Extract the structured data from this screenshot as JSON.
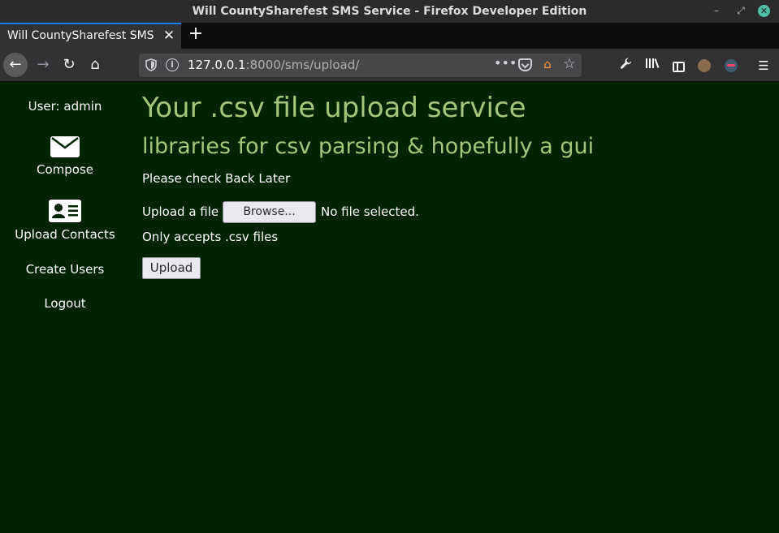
{
  "window": {
    "title": "Will CountySharefest SMS Service - Firefox Developer Edition",
    "minimize_glyph": "–",
    "maximize_glyph": "⤢",
    "close_glyph": "✕"
  },
  "tabs": [
    {
      "label": "Will CountySharefest SMS Service",
      "close_glyph": "✕",
      "active": true
    }
  ],
  "new_tab_glyph": "+",
  "nav": {
    "back_glyph": "←",
    "forward_glyph": "→",
    "reload_glyph": "↻",
    "home_glyph": "⌂"
  },
  "urlbar": {
    "host": "127.0.0.1",
    "rest": ":8000/sms/upload/",
    "more_glyph": "•••",
    "star_glyph": "☆",
    "home_glyph": "⌂"
  },
  "toolbar": {
    "wrench_glyph": "🔧",
    "library_glyph": "|||\\",
    "menu_glyph": "☰"
  },
  "sidebar": {
    "user_label": "User: admin",
    "items": [
      {
        "label": "Compose",
        "icon": "envelope-icon"
      },
      {
        "label": "Upload Contacts",
        "icon": "id-card-icon"
      },
      {
        "label": "Create Users"
      },
      {
        "label": "Logout"
      }
    ]
  },
  "main": {
    "heading": "Your .csv file upload service",
    "subheading": "libraries for csv parsing & hopefully a gui",
    "notice": "Please check Back Later",
    "upload_label": "Upload a file",
    "browse_label": "Browse...",
    "file_status": "No file selected.",
    "accepts_text": "Only accepts .csv files",
    "submit_label": "Upload"
  },
  "colors": {
    "page_background": "#002301",
    "heading_color": "#a5c57a",
    "text_color": "#ffffff",
    "accent_tab": "#0a84ff"
  }
}
